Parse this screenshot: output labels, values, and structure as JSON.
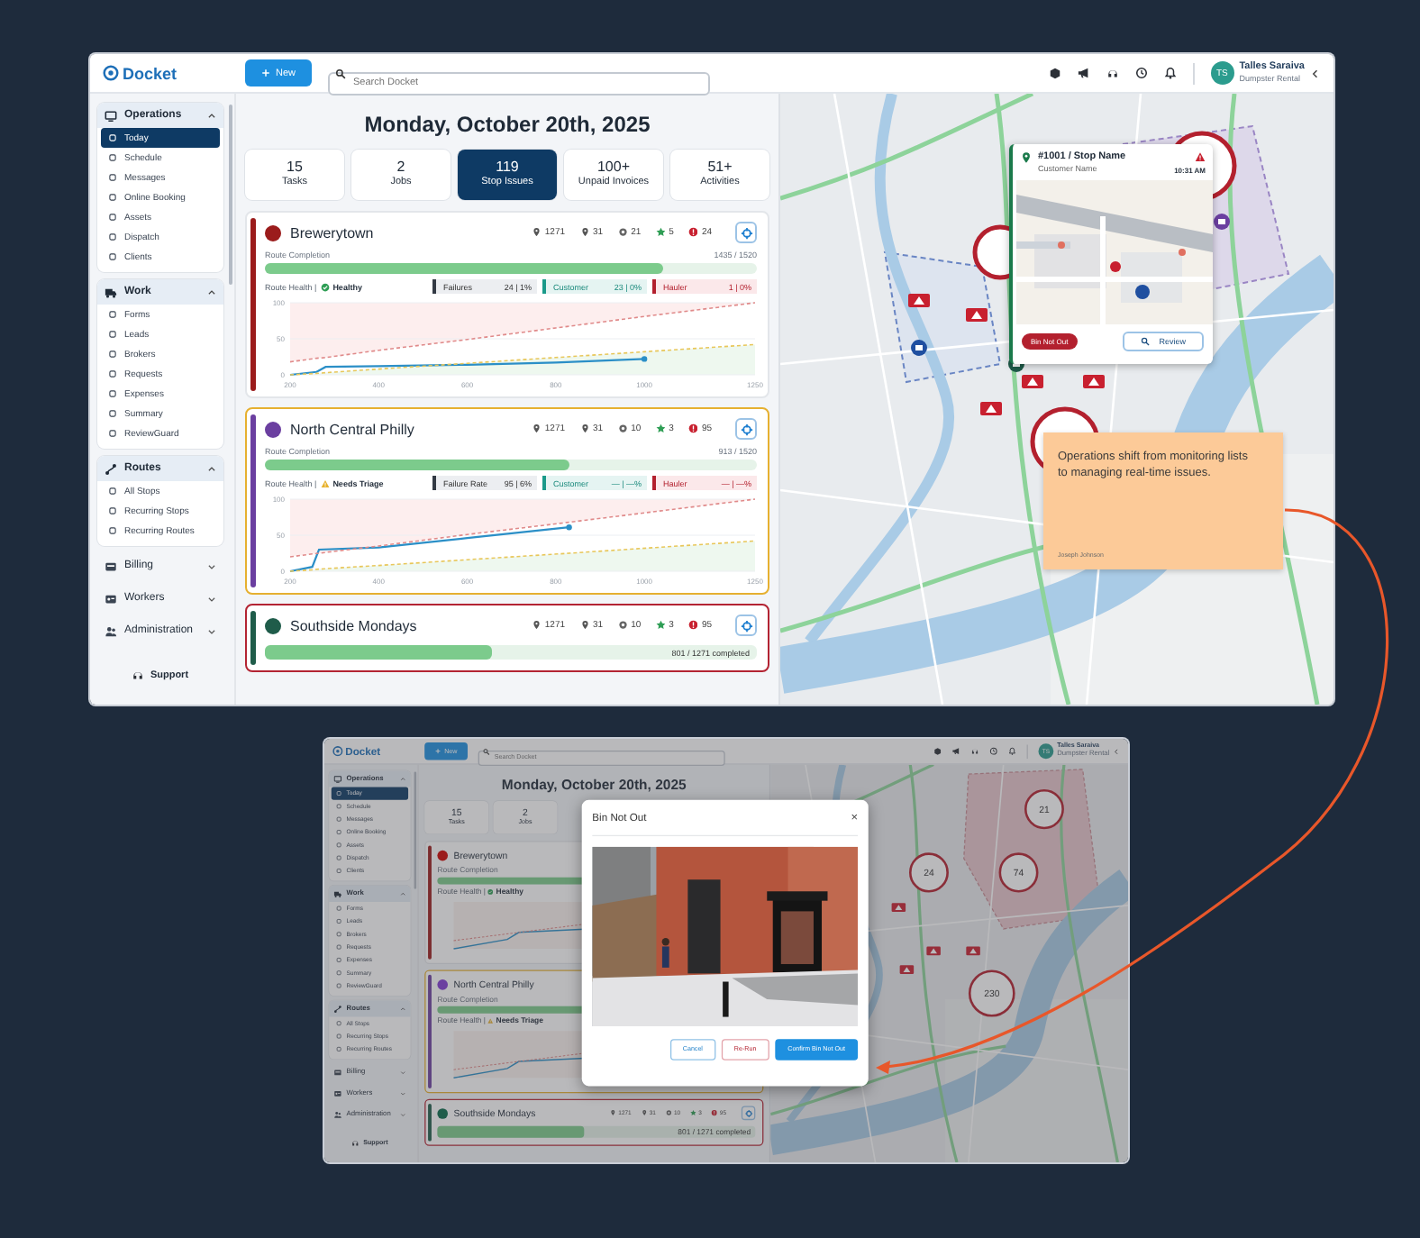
{
  "main_screenshot": {
    "header": {
      "logo": "Docket",
      "new_button": "New",
      "search": {
        "placeholder": "Search Docket"
      },
      "user": {
        "initials": "TS",
        "name": "Talles Saraiva",
        "company": "Dumpster Rental"
      }
    },
    "sidebar": {
      "groups": [
        {
          "label": "Operations",
          "expanded": true,
          "items": [
            {
              "label": "Today",
              "selected": true
            },
            {
              "label": "Schedule",
              "selected": false
            },
            {
              "label": "Messages",
              "selected": false
            },
            {
              "label": "Online Booking",
              "selected": false
            },
            {
              "label": "Assets",
              "selected": false
            },
            {
              "label": "Dispatch",
              "selected": false
            },
            {
              "label": "Clients",
              "selected": false
            }
          ]
        },
        {
          "label": "Work",
          "expanded": true,
          "items": [
            {
              "label": "Forms",
              "selected": false
            },
            {
              "label": "Leads",
              "selected": false
            },
            {
              "label": "Brokers",
              "selected": false
            },
            {
              "label": "Requests",
              "selected": false
            },
            {
              "label": "Expenses",
              "selected": false
            },
            {
              "label": "Summary",
              "selected": false
            },
            {
              "label": "ReviewGuard",
              "selected": false
            }
          ]
        },
        {
          "label": "Routes",
          "expanded": true,
          "items": [
            {
              "label": "All Stops",
              "selected": false
            },
            {
              "label": "Recurring Stops",
              "selected": false
            },
            {
              "label": "Recurring Routes",
              "selected": false
            }
          ]
        },
        {
          "label": "Billing",
          "expanded": false
        },
        {
          "label": "Workers",
          "expanded": false
        },
        {
          "label": "Administration",
          "expanded": false
        }
      ],
      "support": "Support"
    },
    "date": "Monday, October 20th, 2025",
    "tabs": [
      {
        "count": "15",
        "label": "Tasks",
        "selected": false
      },
      {
        "count": "2",
        "label": "Jobs",
        "selected": false
      },
      {
        "count": "119",
        "label": "Stop Issues",
        "selected": true
      },
      {
        "count": "100+",
        "label": "Unpaid Invoices",
        "selected": false
      },
      {
        "count": "51+",
        "label": "Activities",
        "selected": false
      }
    ],
    "routes": [
      {
        "name": "Brewerytown",
        "color": "#9b1c1c",
        "kind": "normal",
        "stats": [
          {
            "kind": "stops",
            "value": "1271"
          },
          {
            "kind": "depots",
            "value": "31"
          },
          {
            "kind": "skipped",
            "value": "21"
          },
          {
            "kind": "rating",
            "value": "5"
          },
          {
            "kind": "issues",
            "value": "24"
          }
        ],
        "completion": {
          "label": "Route Completion",
          "count": "1435 / 1520",
          "level": 0.81
        },
        "health": {
          "label": "Route Health |",
          "kind": "healthy",
          "status": "Healthy"
        },
        "metrics": [
          {
            "kind": "failures",
            "label": "Failures",
            "value": "24 | 1%"
          },
          {
            "kind": "customer",
            "label": "Customer",
            "value": "23 | 0%"
          },
          {
            "kind": "hauler",
            "label": "Hauler",
            "value": "1 | 0%"
          }
        ],
        "chart_data": {
          "type": "line",
          "x": [
            200,
            260,
            280,
            400,
            600,
            800,
            1000,
            1250
          ],
          "series": [
            {
              "color": "#2b8fc7",
              "line_style": "solid",
              "values": [
                0,
                4,
                11,
                12,
                14,
                17,
                22,
                null
              ]
            },
            {
              "color": "#e08a8a",
              "line_style": "dashed",
              "values": [
                18,
                23,
                24,
                34,
                49,
                65,
                81,
                100
              ]
            },
            {
              "color": "#e8c75a",
              "line_style": "dashed",
              "values": [
                0,
                2,
                3,
                8,
                16,
                24,
                32,
                42
              ]
            }
          ],
          "xlim": [
            200,
            1250
          ],
          "ylim": [
            0,
            100
          ],
          "xticks": [
            200,
            400,
            600,
            800,
            1000,
            1250
          ],
          "yticks": [
            0,
            50,
            100
          ]
        }
      },
      {
        "name": "North Central Philly",
        "color": "#6b3fa0",
        "kind": "warning",
        "stats": [
          {
            "kind": "stops",
            "value": "1271"
          },
          {
            "kind": "depots",
            "value": "31"
          },
          {
            "kind": "skipped",
            "value": "10"
          },
          {
            "kind": "rating",
            "value": "3"
          },
          {
            "kind": "issues",
            "value": "95"
          }
        ],
        "completion": {
          "label": "Route Completion",
          "count": "913 / 1520",
          "level": 0.62
        },
        "health": {
          "label": "Route Health |",
          "kind": "triage",
          "status": "Needs Triage"
        },
        "metrics": [
          {
            "kind": "failures",
            "label": "Failure Rate",
            "value": "95 | 6%"
          },
          {
            "kind": "customer",
            "label": "Customer",
            "value": "— | —%"
          },
          {
            "kind": "hauler",
            "label": "Hauler",
            "value": "— | —%"
          }
        ],
        "chart_data": {
          "type": "line",
          "x": [
            200,
            250,
            265,
            400,
            600,
            830,
            1250
          ],
          "series": [
            {
              "color": "#2b8fc7",
              "line_style": "solid",
              "values": [
                0,
                6,
                30,
                33,
                46,
                61,
                null
              ]
            },
            {
              "color": "#e08a8a",
              "line_style": "dashed",
              "values": [
                20,
                24,
                25,
                35,
                51,
                68,
                100
              ]
            },
            {
              "color": "#e8c75a",
              "line_style": "dashed",
              "values": [
                0,
                2,
                3,
                8,
                16,
                25,
                42
              ]
            }
          ],
          "xlim": [
            200,
            1250
          ],
          "ylim": [
            0,
            100
          ],
          "xticks": [
            200,
            400,
            600,
            800,
            1000,
            1250
          ],
          "yticks": [
            0,
            50,
            100
          ]
        }
      },
      {
        "name": "Southside Mondays",
        "color": "#1f5c4a",
        "kind": "critical",
        "stats": [
          {
            "kind": "stops",
            "value": "1271"
          },
          {
            "kind": "depots",
            "value": "31"
          },
          {
            "kind": "skipped",
            "value": "10"
          },
          {
            "kind": "rating",
            "value": "3"
          },
          {
            "kind": "issues",
            "value": "95"
          }
        ],
        "completion": {
          "count": "801 / 1271 completed",
          "level": 0.46
        }
      }
    ],
    "map": {
      "popup": {
        "title": "#1001 / Stop Name",
        "subtitle": "Customer Name",
        "time": "10:31 AM",
        "tag": "Bin Not Out",
        "action": "Review"
      },
      "note": {
        "text": "Operations shift from monitoring lists to managing real-time issues.",
        "author": "Joseph Johnson"
      }
    }
  },
  "modal_screenshot": {
    "header": {
      "logo": "Docket",
      "new_button": "New",
      "search": {
        "placeholder": "Search Docket"
      },
      "user": {
        "initials": "TS",
        "name": "Talles Saraiva",
        "company": "Dumpster Rental"
      }
    },
    "sidebar": {
      "groups": [
        {
          "label": "Operations",
          "expanded": true,
          "items": [
            {
              "label": "Today",
              "selected": true
            },
            {
              "label": "Schedule",
              "selected": false
            },
            {
              "label": "Messages",
              "selected": false
            },
            {
              "label": "Online Booking",
              "selected": false
            },
            {
              "label": "Assets",
              "selected": false
            },
            {
              "label": "Dispatch",
              "selected": false
            },
            {
              "label": "Clients",
              "selected": false
            }
          ]
        },
        {
          "label": "Work",
          "expanded": true,
          "items": [
            {
              "label": "Forms",
              "selected": false
            },
            {
              "label": "Leads",
              "selected": false
            },
            {
              "label": "Brokers",
              "selected": false
            },
            {
              "label": "Requests",
              "selected": false
            },
            {
              "label": "Expenses",
              "selected": false
            },
            {
              "label": "Summary",
              "selected": false
            },
            {
              "label": "ReviewGuard",
              "selected": false
            }
          ]
        },
        {
          "label": "Routes",
          "expanded": true,
          "items": [
            {
              "label": "All Stops",
              "selected": false
            },
            {
              "label": "Recurring Stops",
              "selected": false
            },
            {
              "label": "Recurring Routes",
              "selected": false
            }
          ]
        },
        {
          "label": "Billing",
          "expanded": false
        },
        {
          "label": "Workers",
          "expanded": false
        },
        {
          "label": "Administration",
          "expanded": false
        }
      ],
      "support": "Support"
    },
    "date": "Monday, October 20th, 2025",
    "tabs": [
      {
        "count": "15",
        "label": "Tasks",
        "selected": false
      },
      {
        "count": "2",
        "label": "Jobs",
        "selected": false
      }
    ],
    "routes": [
      {
        "name": "Brewerytown",
        "color": "#9b1c1c",
        "kind": "normal",
        "completion": {
          "label": "Route Completion",
          "level": 0.81
        },
        "health": {
          "label": "Route Health |",
          "kind": "healthy",
          "status": "Healthy"
        },
        "chart_preview": true
      },
      {
        "name": "North Central Philly",
        "color": "#6b3fa0",
        "kind": "warning",
        "completion": {
          "label": "Route Completion",
          "level": 0.62
        },
        "health": {
          "label": "Route Health |",
          "kind": "triage",
          "status": "Needs Triage"
        },
        "chart_preview": true
      },
      {
        "name": "Southside Mondays",
        "color": "#1f5c4a",
        "kind": "critical",
        "stats": [
          {
            "kind": "stops",
            "value": "1271"
          },
          {
            "kind": "depots",
            "value": "31"
          },
          {
            "kind": "skipped",
            "value": "10"
          },
          {
            "kind": "rating",
            "value": "3"
          },
          {
            "kind": "issues",
            "value": "95"
          }
        ],
        "completion": {
          "count": "801 / 1271 completed",
          "level": 0.46
        }
      }
    ],
    "map": {
      "clusters": [
        {
          "count": "21"
        },
        {
          "count": "24"
        },
        {
          "count": "74"
        },
        {
          "count": "230"
        }
      ]
    },
    "modal": {
      "title": "Bin Not Out",
      "close": "×",
      "buttons": [
        {
          "kind": "cancel",
          "label": "Cancel"
        },
        {
          "kind": "rerun",
          "label": "Re-Run"
        },
        {
          "kind": "confirm",
          "label": "Confirm Bin Not Out"
        }
      ]
    }
  }
}
